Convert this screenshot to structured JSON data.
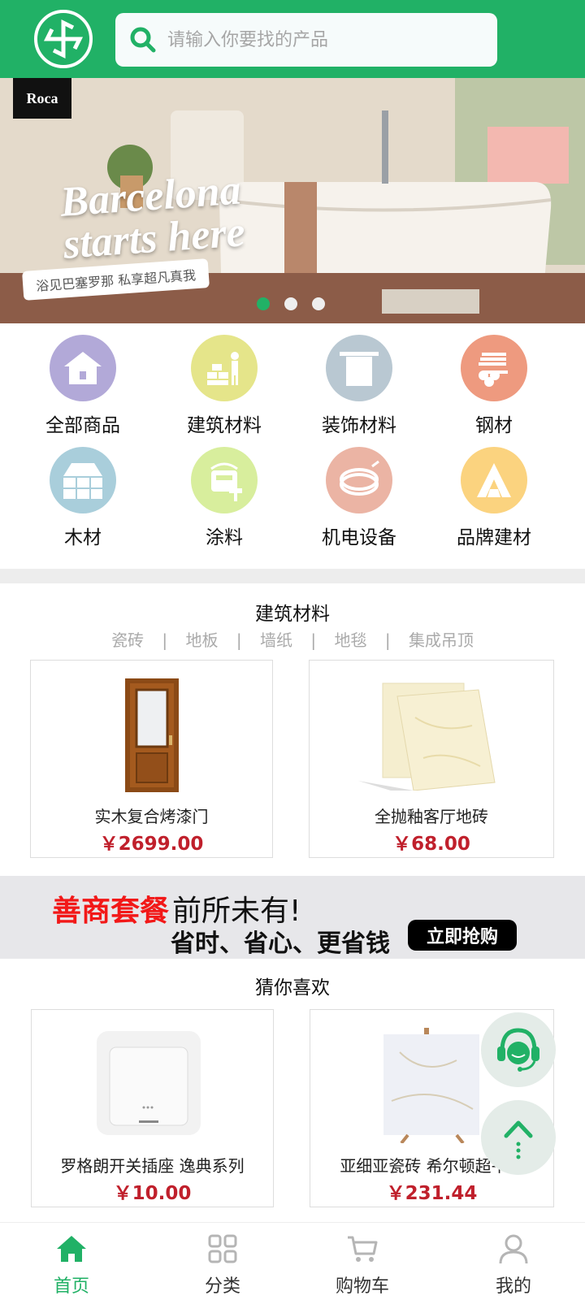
{
  "colors": {
    "brand": "#21b166",
    "price": "#c0202c",
    "promo_red": "#f21818"
  },
  "search": {
    "placeholder": "请输入你要找的产品"
  },
  "banner": {
    "brand": "Roca",
    "title_line1": "Barcelona",
    "title_line2": "starts here",
    "subtitle": "浴见巴塞罗那 私享超凡真我",
    "dots": 3,
    "active_dot": 0
  },
  "categories": [
    {
      "label": "全部商品",
      "icon": "house-icon",
      "color": "#b2a9d8"
    },
    {
      "label": "建筑材料",
      "icon": "worker-bricks-icon",
      "color": "#e5e58a"
    },
    {
      "label": "装饰材料",
      "icon": "towel-rack-icon",
      "color": "#b9c8d2"
    },
    {
      "label": "钢材",
      "icon": "steel-pipes-icon",
      "color": "#ee9a7f"
    },
    {
      "label": "木材",
      "icon": "wood-planks-icon",
      "color": "#a9cedb"
    },
    {
      "label": "涂料",
      "icon": "paint-bucket-icon",
      "color": "#d8ee9d"
    },
    {
      "label": "机电设备",
      "icon": "cable-coil-icon",
      "color": "#ebb4a4"
    },
    {
      "label": "品牌建材",
      "icon": "brand-a-icon",
      "color": "#fbd37f"
    }
  ],
  "section1": {
    "title": "建筑材料",
    "subcategories": [
      "瓷砖",
      "地板",
      "墙纸",
      "地毯",
      "集成吊顶"
    ],
    "separator": "|",
    "products": [
      {
        "name": "实木复合烤漆门",
        "price": "￥2699.00"
      },
      {
        "name": "全抛釉客厅地砖",
        "price": "￥68.00"
      }
    ]
  },
  "promo": {
    "red_text": "善商套餐",
    "black_text": "前所未有!",
    "subtitle": "省时、省心、更省钱",
    "button": "立即抢购"
  },
  "section2": {
    "title": "猜你喜欢",
    "products": [
      {
        "name": "罗格朗开关插座 逸典系列",
        "price": "￥10.00"
      },
      {
        "name": "亚细亚瓷砖 希尔顿超平釉",
        "price": "￥231.44"
      }
    ]
  },
  "floating": {
    "service_icon": "customer-service-icon",
    "top_icon": "back-to-top-icon"
  },
  "tabbar": [
    {
      "label": "首页",
      "icon": "home-icon",
      "active": true
    },
    {
      "label": "分类",
      "icon": "category-grid-icon",
      "active": false
    },
    {
      "label": "购物车",
      "icon": "cart-icon",
      "active": false
    },
    {
      "label": "我的",
      "icon": "user-icon",
      "active": false
    }
  ]
}
